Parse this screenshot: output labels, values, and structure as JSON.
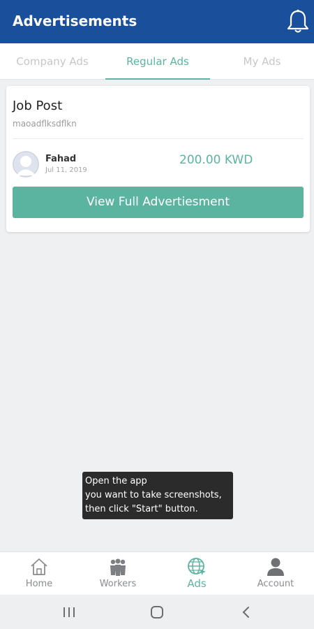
{
  "header": {
    "title": "Advertisements",
    "icon": "bell-icon"
  },
  "tabs": [
    {
      "label": "Company Ads",
      "active": false
    },
    {
      "label": "Regular Ads",
      "active": true
    },
    {
      "label": "My Ads",
      "active": false
    }
  ],
  "ad": {
    "title": "Job Post",
    "description": "maoadflksdflkn",
    "author": "Fahad",
    "date": "Jul 11, 2019",
    "price": "200.00 KWD",
    "button_label": "View Full Advertiesment"
  },
  "toast": {
    "lines": [
      "Open the app",
      "you want to take screenshots,",
      "then click \"Start\" button."
    ]
  },
  "bottom_nav": [
    {
      "label": "Home",
      "icon": "home-icon",
      "active": false
    },
    {
      "label": "Workers",
      "icon": "workers-icon",
      "active": false
    },
    {
      "label": "Ads",
      "icon": "globe-icon",
      "active": true
    },
    {
      "label": "Account",
      "icon": "account-icon",
      "active": false
    }
  ],
  "system_bar": [
    "recents-icon",
    "home-circle-icon",
    "back-icon"
  ],
  "colors": {
    "header": "#1a4f9c",
    "accent": "#5bb49f",
    "background": "#eff0f2"
  }
}
